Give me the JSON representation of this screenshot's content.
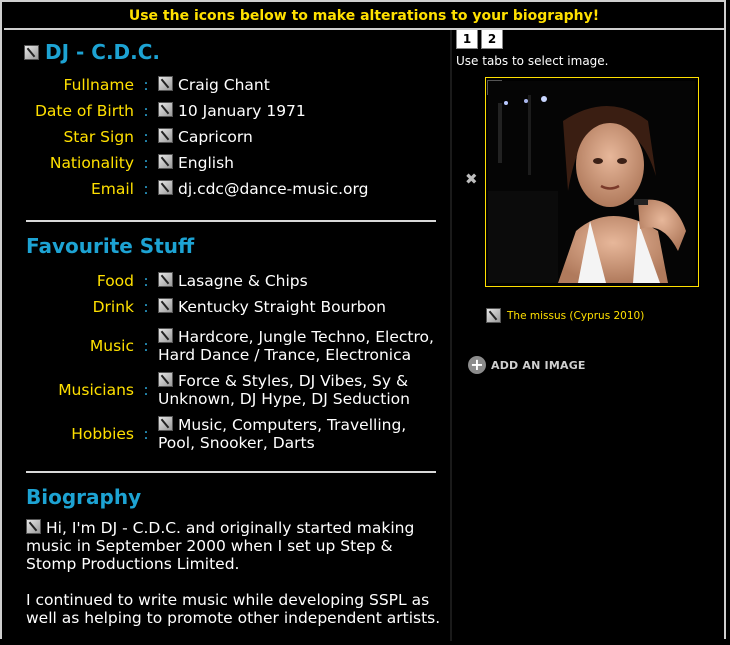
{
  "banner": "Use the icons below to make alterations to your biography!",
  "profile": {
    "name": "DJ - C.D.C.",
    "fields": [
      {
        "label": "Fullname",
        "value": "Craig Chant"
      },
      {
        "label": "Date of Birth",
        "value": "10 January 1971"
      },
      {
        "label": "Star Sign",
        "value": "Capricorn"
      },
      {
        "label": "Nationality",
        "value": "English"
      },
      {
        "label": "Email",
        "value": "dj.cdc@dance-music.org"
      }
    ]
  },
  "favourites": {
    "heading": "Favourite Stuff",
    "fields": [
      {
        "label": "Food",
        "value": "Lasagne & Chips"
      },
      {
        "label": "Drink",
        "value": "Kentucky Straight Bourbon"
      },
      {
        "label": "Music",
        "value": "Hardcore, Jungle Techno, Electro, Hard Dance / Trance, Electronica"
      },
      {
        "label": "Musicians",
        "value": "Force & Styles, DJ Vibes, Sy & Unknown, DJ Hype, DJ Seduction"
      },
      {
        "label": "Hobbies",
        "value": "Music, Computers, Travelling, Pool, Snooker, Darts"
      }
    ]
  },
  "biography": {
    "heading": "Biography",
    "paragraphs": [
      "Hi, I'm DJ - C.D.C. and originally started making music in September 2000 when I set up Step & Stomp Productions Limited.",
      "I continued to write music while developing SSPL as well as helping to promote other independent artists."
    ]
  },
  "gallery": {
    "tabs": [
      "1",
      "2"
    ],
    "hint": "Use tabs to select image.",
    "caption": "The missus (Cyprus 2010)",
    "add_label": "ADD AN IMAGE",
    "delete_glyph": "✖"
  },
  "colors": {
    "accent": "#1da3d3",
    "label": "#ffe000",
    "background": "#000000"
  }
}
